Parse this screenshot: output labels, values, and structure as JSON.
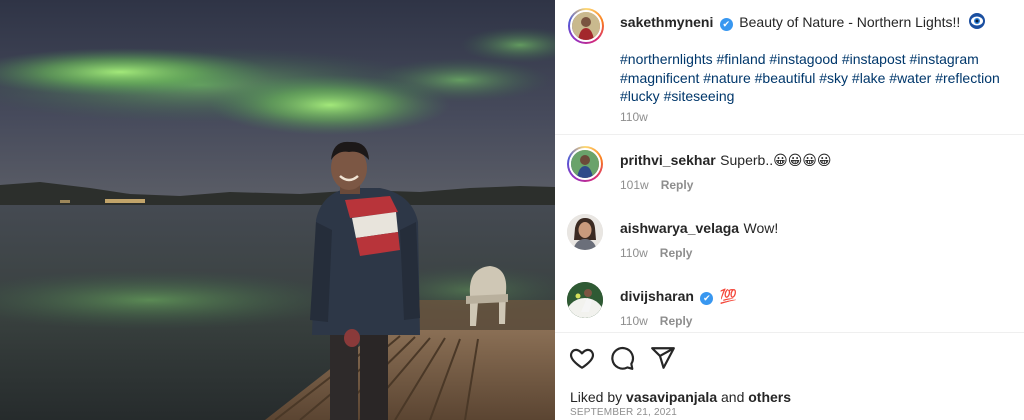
{
  "post": {
    "author": "sakethmyneni",
    "caption": "Beauty of Nature - Northern Lights!!",
    "hashtags": "#northernlights #finland #instagood #instapost #instagram #magnificent #nature #beautiful #sky #lake #water #reflection #lucky #siteseeing",
    "caption_time": "110w",
    "verified_mark": "✔"
  },
  "comments": [
    {
      "user": "prithvi_sekhar",
      "text": "Superb..😀😀😀😀",
      "time": "101w",
      "reply": "Reply"
    },
    {
      "user": "aishwarya_velaga",
      "text": "Wow!",
      "time": "110w",
      "reply": "Reply"
    },
    {
      "user": "divijsharan",
      "text": "💯",
      "time": "110w",
      "reply": "Reply"
    }
  ],
  "likes": {
    "prefix": "Liked by",
    "user": "vasavipanjala",
    "joiner": "and",
    "others": "others"
  },
  "date": "SEPTEMBER 21, 2021",
  "colors": {
    "link": "#00376b",
    "verified": "#3897f0",
    "muted": "#8e8e8e",
    "aurora": "#7ed86a"
  },
  "icons": [
    "heart-icon",
    "comment-icon",
    "share-icon",
    "eye-emoji-icon",
    "verified-badge-icon"
  ]
}
